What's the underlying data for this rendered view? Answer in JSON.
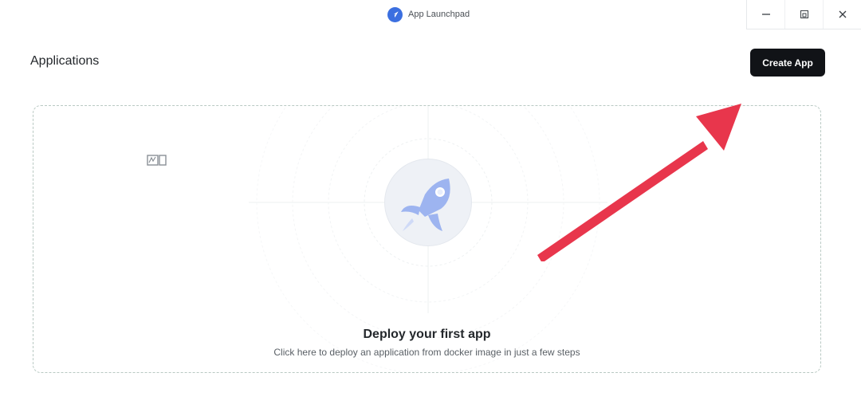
{
  "window": {
    "title": "App Launchpad",
    "controls": [
      "minimize-icon",
      "restore-icon",
      "close-icon"
    ]
  },
  "header": {
    "title": "Applications",
    "create_button_label": "Create App"
  },
  "empty_state": {
    "title": "Deploy your first app",
    "subtitle": "Click here to deploy an application from docker image in just a few steps",
    "icon": "rocket-icon"
  },
  "annotation": {
    "icon": "red-arrow-icon",
    "color": "#e8364c"
  },
  "colors": {
    "primary_button": "#111317",
    "app_icon": "#3b6fe0",
    "rocket": "#9db4f0",
    "card_border": "#b9c9c3"
  }
}
